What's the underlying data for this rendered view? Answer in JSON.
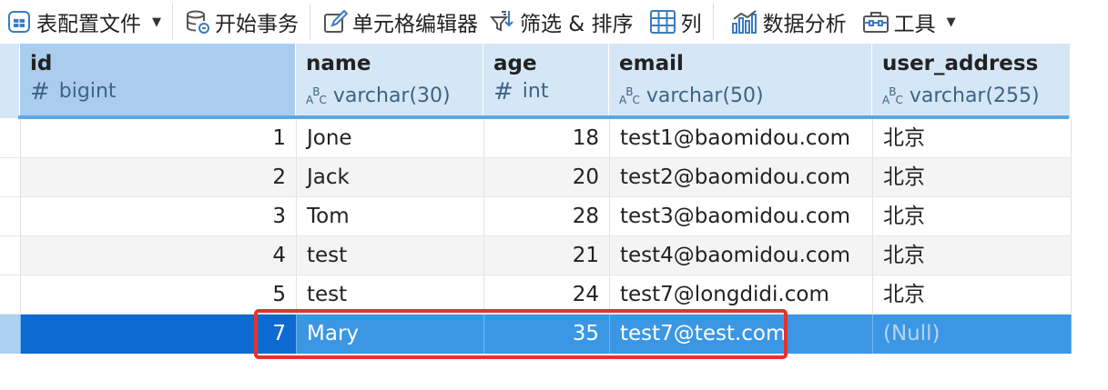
{
  "toolbar": {
    "table_config": "表配置文件",
    "begin_transaction": "开始事务",
    "cell_editor": "单元格编辑器",
    "filter_sort": "筛选 & 排序",
    "columns": "列",
    "data_analysis": "数据分析",
    "tools": "工具"
  },
  "columns": [
    {
      "name": "id",
      "type": "bigint",
      "type_icon": "hash-icon"
    },
    {
      "name": "name",
      "type": "varchar(30)",
      "type_icon": "abc-icon"
    },
    {
      "name": "age",
      "type": "int",
      "type_icon": "hash-icon"
    },
    {
      "name": "email",
      "type": "varchar(50)",
      "type_icon": "abc-icon"
    },
    {
      "name": "user_address",
      "type": "varchar(255)",
      "type_icon": "abc-icon"
    }
  ],
  "rows": [
    {
      "id": "1",
      "name": "Jone",
      "age": "18",
      "email": "test1@baomidou.com",
      "user_address": "北京"
    },
    {
      "id": "2",
      "name": "Jack",
      "age": "20",
      "email": "test2@baomidou.com",
      "user_address": "北京"
    },
    {
      "id": "3",
      "name": "Tom",
      "age": "28",
      "email": "test3@baomidou.com",
      "user_address": "北京"
    },
    {
      "id": "4",
      "name": "test",
      "age": "21",
      "email": "test4@baomidou.com",
      "user_address": "北京"
    },
    {
      "id": "5",
      "name": "test",
      "age": "24",
      "email": "test7@longdidi.com",
      "user_address": "北京"
    },
    {
      "id": "7",
      "name": "Mary",
      "age": "35",
      "email": "test7@test.com",
      "user_address": "(Null)"
    }
  ],
  "selected_row_index": 5,
  "colors": {
    "header_bg": "#d5e7f6",
    "selected_row": "#3b97e4",
    "selected_id_cell": "#0c6ad0",
    "highlight_border": "#e5322d",
    "alt_row": "#f4f4f4"
  }
}
